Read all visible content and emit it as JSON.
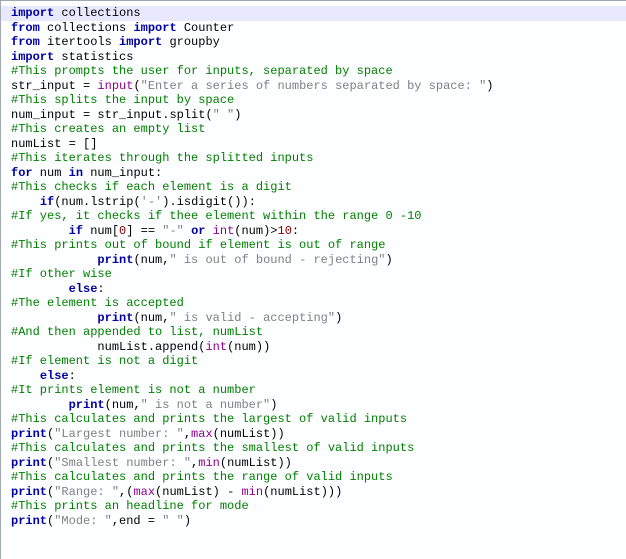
{
  "code": {
    "lines": [
      {
        "highlight": true,
        "indent": 0,
        "tokens": [
          [
            "kw",
            "import"
          ],
          [
            "id",
            " collections"
          ]
        ]
      },
      {
        "highlight": false,
        "indent": 0,
        "tokens": [
          [
            "kw",
            "from"
          ],
          [
            "id",
            " collections "
          ],
          [
            "kw",
            "import"
          ],
          [
            "id",
            " Counter"
          ]
        ]
      },
      {
        "highlight": false,
        "indent": 0,
        "tokens": [
          [
            "kw",
            "from"
          ],
          [
            "id",
            " itertools "
          ],
          [
            "kw",
            "import"
          ],
          [
            "id",
            " groupby"
          ]
        ]
      },
      {
        "highlight": false,
        "indent": 0,
        "tokens": [
          [
            "kw",
            "import"
          ],
          [
            "id",
            " statistics"
          ]
        ]
      },
      {
        "highlight": false,
        "indent": 0,
        "tokens": [
          [
            "id",
            ""
          ]
        ]
      },
      {
        "highlight": false,
        "indent": 0,
        "tokens": [
          [
            "cm",
            "#This prompts the user for inputs, separated by space"
          ]
        ]
      },
      {
        "highlight": false,
        "indent": 0,
        "tokens": [
          [
            "id",
            "str_input "
          ],
          [
            "op",
            "="
          ],
          [
            "id",
            " "
          ],
          [
            "bi",
            "input"
          ],
          [
            "op",
            "("
          ],
          [
            "st",
            "\"Enter a series of numbers separated by space: \""
          ],
          [
            "op",
            ")"
          ]
        ]
      },
      {
        "highlight": false,
        "indent": 0,
        "tokens": [
          [
            "cm",
            "#This splits the input by space"
          ]
        ]
      },
      {
        "highlight": false,
        "indent": 0,
        "tokens": [
          [
            "id",
            "num_input "
          ],
          [
            "op",
            "="
          ],
          [
            "id",
            " str_input"
          ],
          [
            "op",
            "."
          ],
          [
            "id",
            "split"
          ],
          [
            "op",
            "("
          ],
          [
            "st",
            "\" \""
          ],
          [
            "op",
            ")"
          ]
        ]
      },
      {
        "highlight": false,
        "indent": 0,
        "tokens": [
          [
            "cm",
            "#This creates an empty list"
          ]
        ]
      },
      {
        "highlight": false,
        "indent": 0,
        "tokens": [
          [
            "id",
            "numList "
          ],
          [
            "op",
            "="
          ],
          [
            "id",
            " "
          ],
          [
            "op",
            "[]"
          ]
        ]
      },
      {
        "highlight": false,
        "indent": 0,
        "tokens": [
          [
            "cm",
            "#This iterates through the splitted inputs"
          ]
        ]
      },
      {
        "highlight": false,
        "indent": 0,
        "tokens": [
          [
            "kw",
            "for"
          ],
          [
            "id",
            " num "
          ],
          [
            "kw",
            "in"
          ],
          [
            "id",
            " num_input"
          ],
          [
            "op",
            ":"
          ]
        ]
      },
      {
        "highlight": false,
        "indent": 0,
        "tokens": [
          [
            "cm",
            "#This checks if each element is a digit"
          ]
        ]
      },
      {
        "highlight": false,
        "indent": 1,
        "tokens": [
          [
            "kw",
            "if"
          ],
          [
            "op",
            "("
          ],
          [
            "id",
            "num"
          ],
          [
            "op",
            "."
          ],
          [
            "id",
            "lstrip"
          ],
          [
            "op",
            "("
          ],
          [
            "st",
            "'-'"
          ],
          [
            "op",
            ")"
          ],
          [
            "op",
            "."
          ],
          [
            "id",
            "isdigit"
          ],
          [
            "op",
            "()):"
          ]
        ]
      },
      {
        "highlight": false,
        "indent": 0,
        "tokens": [
          [
            "cm",
            "#If yes, it checks if thee element within the range 0 -10"
          ]
        ]
      },
      {
        "highlight": false,
        "indent": 2,
        "tokens": [
          [
            "kw",
            "if"
          ],
          [
            "id",
            " num"
          ],
          [
            "op",
            "["
          ],
          [
            "num",
            "0"
          ],
          [
            "op",
            "]"
          ],
          [
            "id",
            " "
          ],
          [
            "op",
            "=="
          ],
          [
            "id",
            " "
          ],
          [
            "st",
            "\"-\""
          ],
          [
            "id",
            " "
          ],
          [
            "kw",
            "or"
          ],
          [
            "id",
            " "
          ],
          [
            "bi",
            "int"
          ],
          [
            "op",
            "("
          ],
          [
            "id",
            "num"
          ],
          [
            "op",
            ")>"
          ],
          [
            "num",
            "10"
          ],
          [
            "op",
            ":"
          ]
        ]
      },
      {
        "highlight": false,
        "indent": 0,
        "tokens": [
          [
            "cm",
            "#This prints out of bound if element is out of range"
          ]
        ]
      },
      {
        "highlight": false,
        "indent": 3,
        "tokens": [
          [
            "kw",
            "print"
          ],
          [
            "op",
            "("
          ],
          [
            "id",
            "num"
          ],
          [
            "op",
            ","
          ],
          [
            "st",
            "\" is out of bound - rejecting\""
          ],
          [
            "op",
            ")"
          ]
        ]
      },
      {
        "highlight": false,
        "indent": 0,
        "tokens": [
          [
            "cm",
            "#If other wise"
          ]
        ]
      },
      {
        "highlight": false,
        "indent": 2,
        "tokens": [
          [
            "kw",
            "else"
          ],
          [
            "op",
            ":"
          ]
        ]
      },
      {
        "highlight": false,
        "indent": 0,
        "tokens": [
          [
            "cm",
            "#The element is accepted"
          ]
        ]
      },
      {
        "highlight": false,
        "indent": 3,
        "tokens": [
          [
            "kw",
            "print"
          ],
          [
            "op",
            "("
          ],
          [
            "id",
            "num"
          ],
          [
            "op",
            ","
          ],
          [
            "st",
            "\" is valid - accepting\""
          ],
          [
            "op",
            ")"
          ]
        ]
      },
      {
        "highlight": false,
        "indent": 0,
        "tokens": [
          [
            "cm",
            "#And then appended to list, numList"
          ]
        ]
      },
      {
        "highlight": false,
        "indent": 3,
        "tokens": [
          [
            "id",
            "numList"
          ],
          [
            "op",
            "."
          ],
          [
            "id",
            "append"
          ],
          [
            "op",
            "("
          ],
          [
            "bi",
            "int"
          ],
          [
            "op",
            "("
          ],
          [
            "id",
            "num"
          ],
          [
            "op",
            "))"
          ]
        ]
      },
      {
        "highlight": false,
        "indent": 0,
        "tokens": [
          [
            "cm",
            "#If element is not a digit"
          ]
        ]
      },
      {
        "highlight": false,
        "indent": 1,
        "tokens": [
          [
            "kw",
            "else"
          ],
          [
            "op",
            ":"
          ]
        ]
      },
      {
        "highlight": false,
        "indent": 0,
        "tokens": [
          [
            "cm",
            "#It prints element is not a number"
          ]
        ]
      },
      {
        "highlight": false,
        "indent": 2,
        "tokens": [
          [
            "kw",
            "print"
          ],
          [
            "op",
            "("
          ],
          [
            "id",
            "num"
          ],
          [
            "op",
            ","
          ],
          [
            "st",
            "\" is not a number\""
          ],
          [
            "op",
            ")"
          ]
        ]
      },
      {
        "highlight": false,
        "indent": 0,
        "tokens": [
          [
            "cm",
            "#This calculates and prints the largest of valid inputs"
          ]
        ]
      },
      {
        "highlight": false,
        "indent": 0,
        "tokens": [
          [
            "kw",
            "print"
          ],
          [
            "op",
            "("
          ],
          [
            "st",
            "\"Largest number: \""
          ],
          [
            "op",
            ","
          ],
          [
            "bi",
            "max"
          ],
          [
            "op",
            "("
          ],
          [
            "id",
            "numList"
          ],
          [
            "op",
            "))"
          ]
        ]
      },
      {
        "highlight": false,
        "indent": 0,
        "tokens": [
          [
            "cm",
            "#This calculates and prints the smallest of valid inputs"
          ]
        ]
      },
      {
        "highlight": false,
        "indent": 0,
        "tokens": [
          [
            "kw",
            "print"
          ],
          [
            "op",
            "("
          ],
          [
            "st",
            "\"Smallest number: \""
          ],
          [
            "op",
            ","
          ],
          [
            "bi",
            "min"
          ],
          [
            "op",
            "("
          ],
          [
            "id",
            "numList"
          ],
          [
            "op",
            "))"
          ]
        ]
      },
      {
        "highlight": false,
        "indent": 0,
        "tokens": [
          [
            "cm",
            "#This calculates and prints the range of valid inputs"
          ]
        ]
      },
      {
        "highlight": false,
        "indent": 0,
        "tokens": [
          [
            "kw",
            "print"
          ],
          [
            "op",
            "("
          ],
          [
            "st",
            "\"Range: \""
          ],
          [
            "op",
            ",("
          ],
          [
            "bi",
            "max"
          ],
          [
            "op",
            "("
          ],
          [
            "id",
            "numList"
          ],
          [
            "op",
            ")"
          ],
          [
            "id",
            " "
          ],
          [
            "op",
            "-"
          ],
          [
            "id",
            " "
          ],
          [
            "bi",
            "min"
          ],
          [
            "op",
            "("
          ],
          [
            "id",
            "numList"
          ],
          [
            "op",
            ")))"
          ]
        ]
      },
      {
        "highlight": false,
        "indent": 0,
        "tokens": [
          [
            "cm",
            "#This prints an headline for mode"
          ]
        ]
      },
      {
        "highlight": false,
        "indent": 0,
        "tokens": [
          [
            "kw",
            "print"
          ],
          [
            "op",
            "("
          ],
          [
            "st",
            "\"Mode: \""
          ],
          [
            "op",
            ","
          ],
          [
            "id",
            "end "
          ],
          [
            "op",
            "="
          ],
          [
            "id",
            " "
          ],
          [
            "st",
            "\" \""
          ],
          [
            "op",
            ")"
          ]
        ]
      }
    ]
  }
}
